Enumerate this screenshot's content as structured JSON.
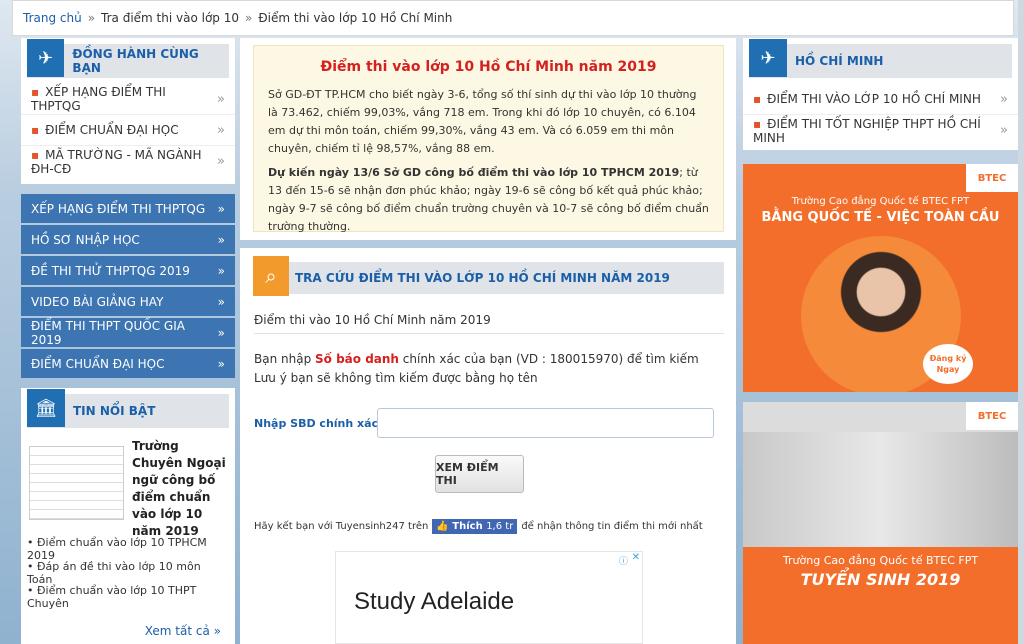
{
  "breadcrumb": {
    "home": "Trang chủ",
    "level2": "Tra điểm thi vào lớp 10",
    "level3": "Điểm thi vào lớp 10 Hồ Chí Minh",
    "sep": "»"
  },
  "left": {
    "box1_title": "ĐỒNG HÀNH CÙNG BẠN",
    "box1_items": [
      "XẾP HẠNG ĐIỂM THI THPTQG",
      "ĐIỂM CHUẨN ĐẠI HỌC",
      "MÃ TRƯỜNG - MÃ NGÀNH ĐH-CĐ"
    ],
    "nav": [
      "XẾP HẠNG ĐIỂM THI THPTQG",
      "HỒ SƠ NHẬP HỌC",
      "ĐỀ THI THỬ THPTQG 2019",
      "VIDEO BÀI GIẢNG HAY",
      "ĐIỂM THI THPT QUỐC GIA 2019",
      "ĐIỂM CHUẨN ĐẠI HỌC"
    ],
    "box2_title": "TIN NỔI BẬT",
    "featured": "Trường Chuyên Ngoại ngữ công bố điểm chuẩn vào lớp 10 năm 2019",
    "news": [
      "Điểm chuẩn vào lớp 10 TPHCM 2019",
      "Đáp án đề thi vào lớp 10 môn Toán",
      "Điểm chuẩn vào lớp 10 THPT Chuyên"
    ],
    "see_all": "Xem tất cả"
  },
  "main": {
    "notice_title": "Điểm thi vào lớp 10 Hồ Chí Minh năm 2019",
    "notice_p1": "Sở GD-ĐT TP.HCM cho biết ngày 3-6, tổng số thí sinh dự thi vào lớp 10 thường là 73.462, chiếm 99,03%, vắng 718 em. Trong khi đó lớp 10 chuyên, có 6.104 em dự thi môn toán, chiếm 99,30%, vắng 43 em. Và có 6.059 em thi môn chuyên, chiếm tỉ lệ 98,57%, vắng 88 em.",
    "notice_p2_bold": "Dự kiến ngày 13/6 Sở GD công bố điểm thi vào lớp 10 TPHCM 2019",
    "notice_p2": "; từ 13 đến 15-6 sẽ nhận đơn phúc khảo; ngày 19-6 sẽ công bố kết quả phúc khảo; ngày 9-7 sẽ công bố điểm chuẩn trường chuyên và 10-7 sẽ công bố điểm chuẩn trường thường.",
    "search_title": "TRA CỨU ĐIỂM THI VÀO LỚP 10 HỒ CHÍ MINH NĂM 2019",
    "subtitle": "Điểm thi vào 10 Hồ Chí Minh năm 2019",
    "instr_pre": "Bạn nhập ",
    "instr_bold": "Số báo danh",
    "instr_post": " chính xác của bạn (VD : 180015970) để tìm kiếm",
    "instr2": "Lưu ý bạn sẽ không tìm kiếm được bằng họ tên",
    "input_label": "Nhập SBD chính xác",
    "submit": "XEM ĐIỂM THI",
    "fb_pre": "Hãy kết bạn với Tuyensinh247 trên",
    "fb_like": "Thích",
    "fb_count": "1,6 tr",
    "fb_post": "để nhận thông tin điểm thi mới nhất",
    "ad_text": "Study Adelaide"
  },
  "right": {
    "box_title": "HỒ CHÍ MINH",
    "items": [
      "ĐIỂM THI VÀO LỚP 10 HỒ CHÍ MINH",
      "ĐIỂM THI TỐT NGHIỆP THPT HỒ CHÍ MINH"
    ],
    "ad1_brand": "BTEC",
    "ad1_line1": "Trường Cao đẳng Quốc tế BTEC FPT",
    "ad1_line2": "BẰNG QUỐC TẾ - VIỆC TOÀN CẦU",
    "ad1_badge": "Đăng ký Ngay",
    "ad2_brand": "BTEC",
    "ad2_line1": "Trường Cao đẳng Quốc tế BTEC FPT",
    "ad2_line2": "TUYỂN SINH 2019"
  }
}
